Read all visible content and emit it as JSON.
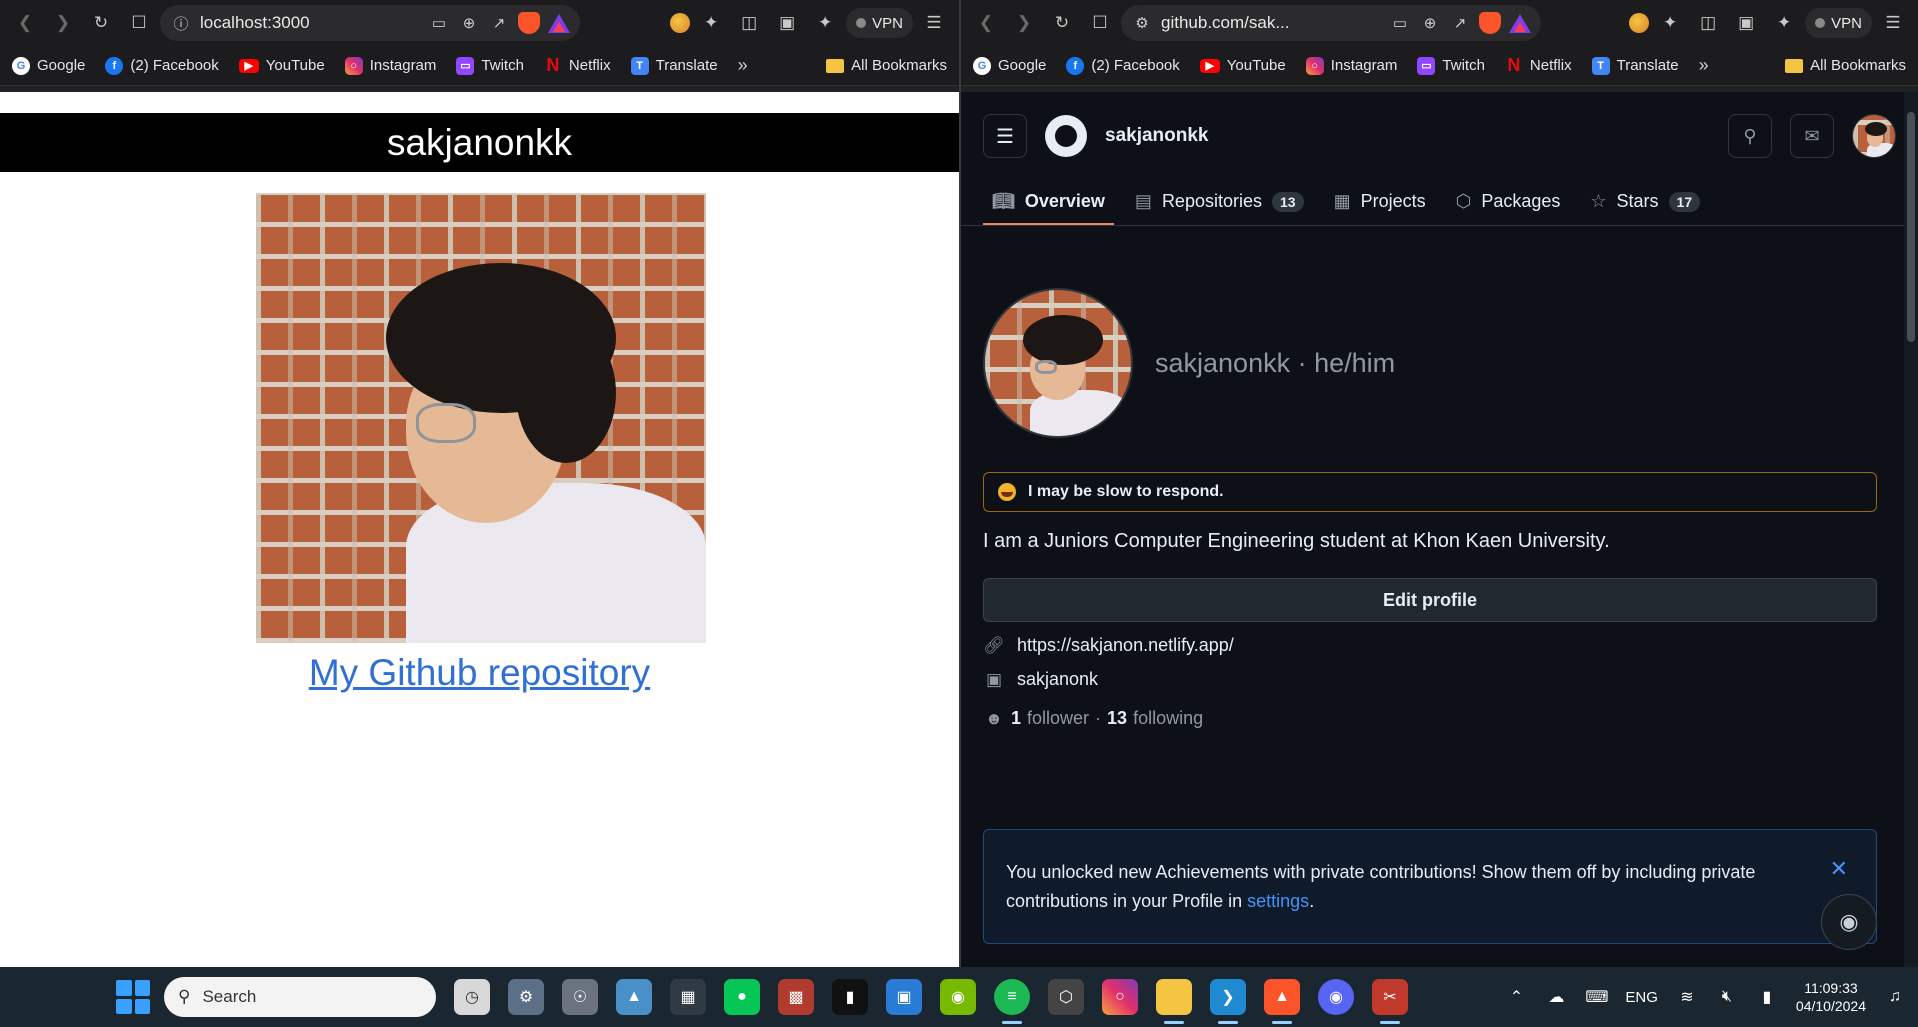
{
  "left_window": {
    "url": "localhost:3000",
    "vpn_label": "VPN",
    "bookmarks": [
      {
        "label": "Google",
        "icon": "google-icon"
      },
      {
        "label": "(2) Facebook",
        "icon": "facebook-icon"
      },
      {
        "label": "YouTube",
        "icon": "youtube-icon"
      },
      {
        "label": "Instagram",
        "icon": "instagram-icon"
      },
      {
        "label": "Twitch",
        "icon": "twitch-icon"
      },
      {
        "label": "Netflix",
        "icon": "netflix-icon"
      },
      {
        "label": "Translate",
        "icon": "translate-icon"
      }
    ],
    "bookmarks_overflow": "»",
    "all_bookmarks": "All Bookmarks",
    "page": {
      "header": "sakjanonkk",
      "link_text": "My Github repository"
    }
  },
  "right_window": {
    "url": "github.com/sak...",
    "vpn_label": "VPN",
    "bookmarks": [
      {
        "label": "Google",
        "icon": "google-icon"
      },
      {
        "label": "(2) Facebook",
        "icon": "facebook-icon"
      },
      {
        "label": "YouTube",
        "icon": "youtube-icon"
      },
      {
        "label": "Instagram",
        "icon": "instagram-icon"
      },
      {
        "label": "Twitch",
        "icon": "twitch-icon"
      },
      {
        "label": "Netflix",
        "icon": "netflix-icon"
      },
      {
        "label": "Translate",
        "icon": "translate-icon"
      }
    ],
    "bookmarks_overflow": "»",
    "all_bookmarks": "All Bookmarks",
    "github": {
      "username": "sakjanonkk",
      "tabs": [
        {
          "label": "Overview",
          "count": "",
          "icon": "book-icon",
          "active": true
        },
        {
          "label": "Repositories",
          "count": "13",
          "icon": "repo-icon",
          "active": false
        },
        {
          "label": "Projects",
          "count": "",
          "icon": "table-icon",
          "active": false
        },
        {
          "label": "Packages",
          "count": "",
          "icon": "package-icon",
          "active": false
        },
        {
          "label": "Stars",
          "count": "17",
          "icon": "star-icon",
          "active": false
        }
      ],
      "handle": "sakjanonkk · he/him",
      "status": "I may be slow to respond.",
      "bio": "I am a Juniors Computer Engineering student at Khon Kaen University.",
      "edit_profile": "Edit profile",
      "website": "https://sakjanon.netlify.app/",
      "instagram": "sakjanonk",
      "followers_count": "1",
      "followers_label": "follower",
      "separator": "·",
      "following_count": "13",
      "following_label": "following",
      "banner_text": "You unlocked new Achievements with private contributions! Show them off by including private contributions in your Profile in",
      "banner_link": "settings",
      "banner_end": ".",
      "accent_color": "#f78166",
      "link_color": "#4493f8"
    }
  },
  "taskbar": {
    "search_placeholder": "Search",
    "apps": [
      "clock-app-icon",
      "settings-icon",
      "media-icon",
      "photos-icon",
      "notes-icon",
      "line-icon",
      "keyboard-app-icon",
      "terminal-icon",
      "window-app-icon",
      "nvidia-icon",
      "spotify-icon",
      "unity-icon",
      "instagram-app-icon",
      "file-explorer-icon",
      "vscode-icon",
      "brave-icon",
      "discord-icon",
      "snipping-tool-icon"
    ],
    "language": "ENG",
    "time": "11:09:33",
    "date": "04/10/2024"
  }
}
